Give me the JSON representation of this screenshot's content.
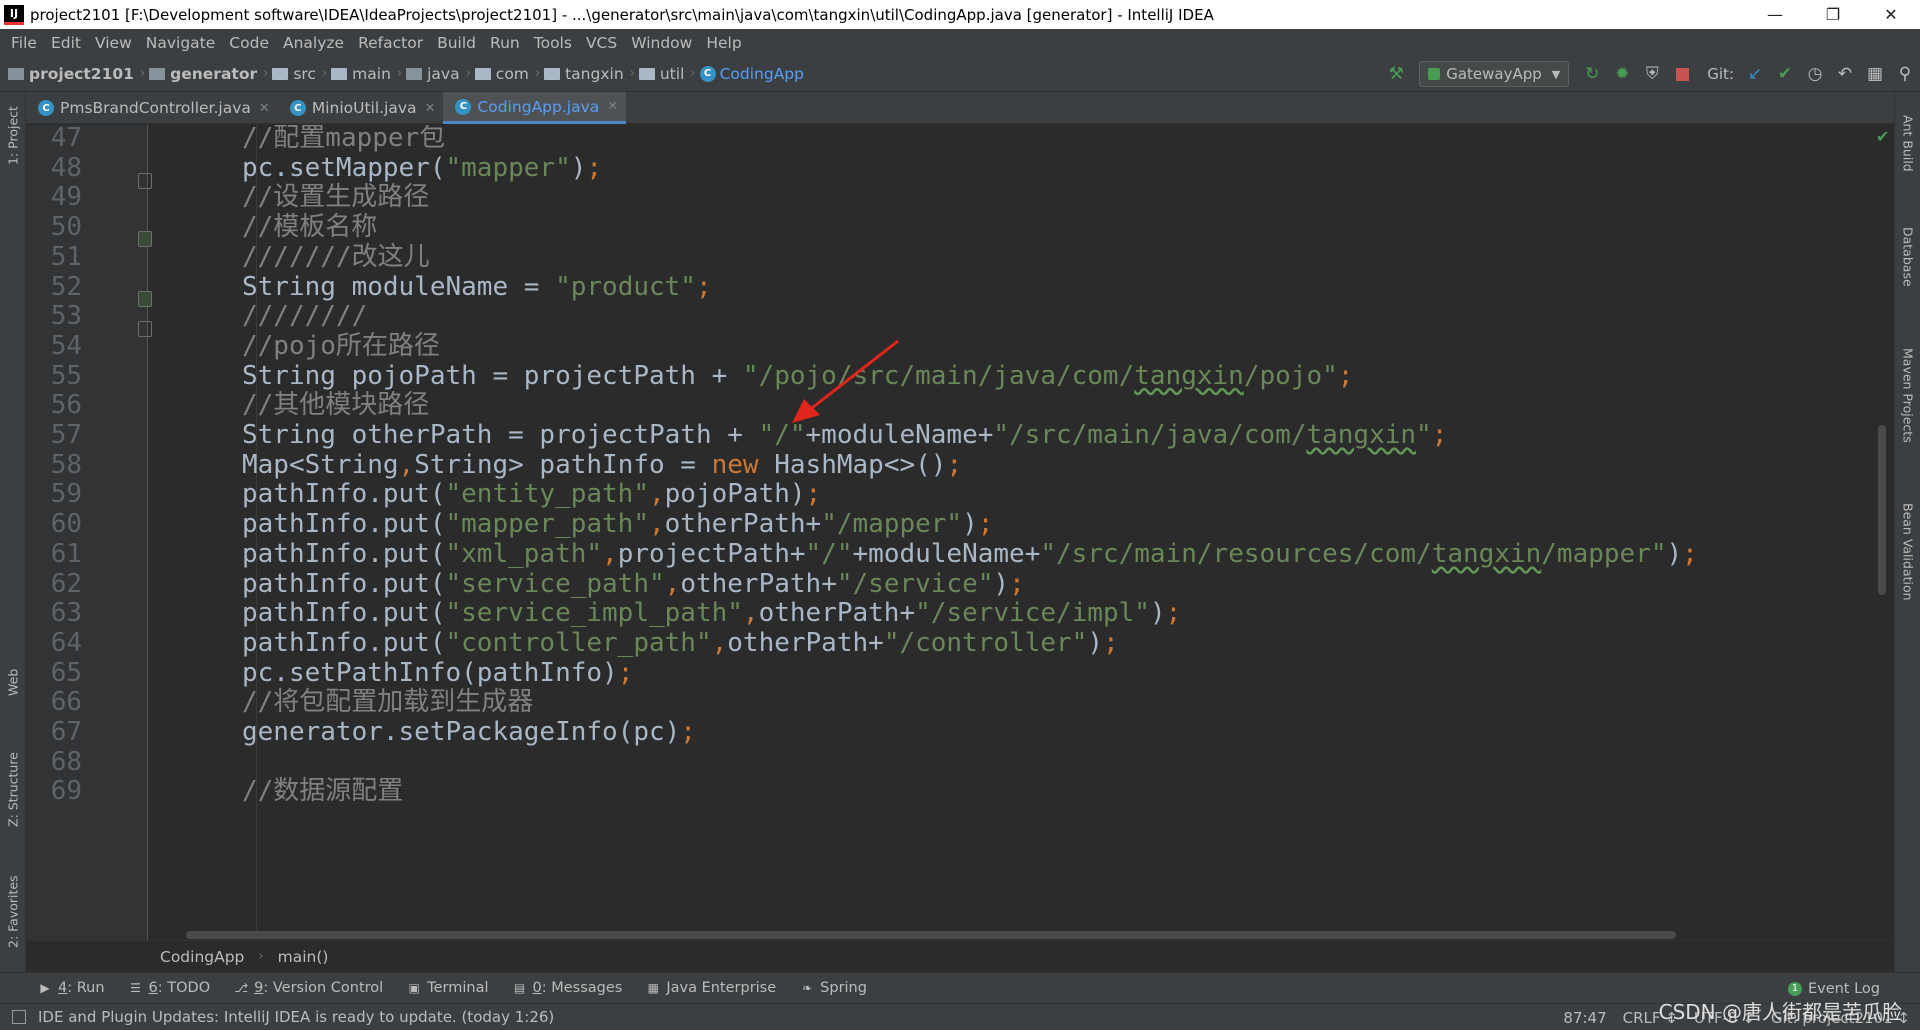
{
  "titlebar": {
    "app_icon": "IJ",
    "title": "project2101 [F:\\Development software\\IDEA\\IdeaProjects\\project2101] - ...\\generator\\src\\main\\java\\com\\tangxin\\util\\CodingApp.java [generator] - IntelliJ IDEA",
    "minimize": "—",
    "restore": "❐",
    "close": "✕"
  },
  "menu": [
    {
      "m": "F",
      "rest": "ile"
    },
    {
      "m": "E",
      "rest": "dit"
    },
    {
      "m": "V",
      "rest": "iew"
    },
    {
      "m": "N",
      "rest": "avigate"
    },
    {
      "m": "C",
      "rest": "ode"
    },
    {
      "m": "",
      "rest": "Analy",
      "tail": "z",
      "end": "e"
    },
    {
      "m": "R",
      "rest": "efactor"
    },
    {
      "m": "B",
      "rest": "uild"
    },
    {
      "m": "R",
      "rest": "u",
      "end": "n"
    },
    {
      "m": "T",
      "rest": "ools"
    },
    {
      "m": "",
      "rest": "VC",
      "tail": "S"
    },
    {
      "m": "W",
      "rest": "indow"
    },
    {
      "m": "H",
      "rest": "elp"
    }
  ],
  "menu_labels": [
    "File",
    "Edit",
    "View",
    "Navigate",
    "Code",
    "Analyze",
    "Refactor",
    "Build",
    "Run",
    "Tools",
    "VCS",
    "Window",
    "Help"
  ],
  "nav": {
    "crumbs": [
      "project2101",
      "generator",
      "src",
      "main",
      "java",
      "com",
      "tangxin",
      "util",
      "CodingApp"
    ],
    "class_icon": "C",
    "run_config": "GatewayApp",
    "git_label": "Git:"
  },
  "tabs": [
    {
      "label": "PmsBrandController.java",
      "icon": "C"
    },
    {
      "label": "MinioUtil.java",
      "icon": "C"
    },
    {
      "label": "CodingApp.java",
      "icon": "C",
      "active": true
    }
  ],
  "left_tools": [
    "1: Project",
    "Web",
    "Z: Structure",
    "2: Favorites"
  ],
  "right_tools": [
    "Ant Build",
    "Database",
    "Maven Projects",
    "Bean Validation"
  ],
  "code_lines": [
    {
      "n": "47",
      "parts": [
        [
          "c-cmt",
          "//配置mapper包"
        ]
      ]
    },
    {
      "n": "48",
      "parts": [
        [
          "c-id",
          "pc.setMapper("
        ],
        [
          "c-str",
          "\"mapper\""
        ],
        [
          "c-id",
          ")"
        ],
        [
          "c-kw",
          ";"
        ]
      ]
    },
    {
      "n": "49",
      "parts": [
        [
          "c-cmt",
          "//设置生成路径"
        ]
      ]
    },
    {
      "n": "50",
      "parts": [
        [
          "c-cmt",
          "//模板名称"
        ]
      ]
    },
    {
      "n": "51",
      "parts": [
        [
          "c-cmt",
          "///////改这儿"
        ]
      ]
    },
    {
      "n": "52",
      "parts": [
        [
          "c-id",
          "String moduleName = "
        ],
        [
          "c-str",
          "\"product\""
        ],
        [
          "c-kw",
          ";"
        ]
      ]
    },
    {
      "n": "53",
      "parts": [
        [
          "c-cmt",
          "////////"
        ]
      ]
    },
    {
      "n": "54",
      "parts": [
        [
          "c-cmt",
          "//pojo所在路径"
        ]
      ]
    },
    {
      "n": "55",
      "parts": [
        [
          "c-id",
          "String pojoPath = projectPath + "
        ],
        [
          "c-str",
          "\"/pojo/src/main/java/com/"
        ],
        [
          "c-str c-typo",
          "tangxin"
        ],
        [
          "c-str",
          "/pojo\""
        ],
        [
          "c-kw",
          ";"
        ]
      ]
    },
    {
      "n": "56",
      "parts": [
        [
          "c-cmt",
          "//其他模块路径"
        ]
      ]
    },
    {
      "n": "57",
      "parts": [
        [
          "c-id",
          "String otherPath = projectPath + "
        ],
        [
          "c-str",
          "\"/\""
        ],
        [
          "c-id",
          "+moduleName+"
        ],
        [
          "c-str",
          "\"/src/main/java/com/"
        ],
        [
          "c-str c-typo",
          "tangxin"
        ],
        [
          "c-str",
          "\""
        ],
        [
          "c-kw",
          ";"
        ]
      ]
    },
    {
      "n": "58",
      "parts": [
        [
          "c-id",
          "Map<String"
        ],
        [
          "c-kw",
          ","
        ],
        [
          "c-id",
          "String> pathInfo = "
        ],
        [
          "c-kw",
          "new "
        ],
        [
          "c-id",
          "HashMap<>()"
        ],
        [
          "c-kw",
          ";"
        ]
      ]
    },
    {
      "n": "59",
      "parts": [
        [
          "c-id",
          "pathInfo.put("
        ],
        [
          "c-str",
          "\"entity_path\""
        ],
        [
          "c-kw",
          ","
        ],
        [
          "c-id",
          "pojoPath)"
        ],
        [
          "c-kw",
          ";"
        ]
      ]
    },
    {
      "n": "60",
      "parts": [
        [
          "c-id",
          "pathInfo.put("
        ],
        [
          "c-str",
          "\"mapper_path\""
        ],
        [
          "c-kw",
          ","
        ],
        [
          "c-id",
          "otherPath+"
        ],
        [
          "c-str",
          "\"/mapper\""
        ],
        [
          "c-id",
          ")"
        ],
        [
          "c-kw",
          ";"
        ]
      ]
    },
    {
      "n": "61",
      "parts": [
        [
          "c-id",
          "pathInfo.put("
        ],
        [
          "c-str",
          "\"xml_path\""
        ],
        [
          "c-kw",
          ","
        ],
        [
          "c-id",
          "projectPath+"
        ],
        [
          "c-str",
          "\"/\""
        ],
        [
          "c-id",
          "+moduleName+"
        ],
        [
          "c-str",
          "\"/src/main/resources/com/"
        ],
        [
          "c-str c-typo",
          "tangxin"
        ],
        [
          "c-str",
          "/mapper\""
        ],
        [
          "c-id",
          ")"
        ],
        [
          "c-kw",
          ";"
        ]
      ]
    },
    {
      "n": "62",
      "parts": [
        [
          "c-id",
          "pathInfo.put("
        ],
        [
          "c-str",
          "\"service_path\""
        ],
        [
          "c-kw",
          ","
        ],
        [
          "c-id",
          "otherPath+"
        ],
        [
          "c-str",
          "\"/service\""
        ],
        [
          "c-id",
          ")"
        ],
        [
          "c-kw",
          ";"
        ]
      ]
    },
    {
      "n": "63",
      "parts": [
        [
          "c-id",
          "pathInfo.put("
        ],
        [
          "c-str",
          "\"service_impl_path\""
        ],
        [
          "c-kw",
          ","
        ],
        [
          "c-id",
          "otherPath+"
        ],
        [
          "c-str",
          "\"/service/impl\""
        ],
        [
          "c-id",
          ")"
        ],
        [
          "c-kw",
          ";"
        ]
      ]
    },
    {
      "n": "64",
      "parts": [
        [
          "c-id",
          "pathInfo.put("
        ],
        [
          "c-str",
          "\"controller_path\""
        ],
        [
          "c-kw",
          ","
        ],
        [
          "c-id",
          "otherPath+"
        ],
        [
          "c-str",
          "\"/controller\""
        ],
        [
          "c-id",
          ")"
        ],
        [
          "c-kw",
          ";"
        ]
      ]
    },
    {
      "n": "65",
      "parts": [
        [
          "c-id",
          "pc.setPathInfo(pathInfo)"
        ],
        [
          "c-kw",
          ";"
        ]
      ]
    },
    {
      "n": "66",
      "parts": [
        [
          "c-cmt",
          "//将包配置加载到生成器"
        ]
      ]
    },
    {
      "n": "67",
      "parts": [
        [
          "c-id",
          "generator.setPackageInfo(pc)"
        ],
        [
          "c-kw",
          ";"
        ]
      ]
    },
    {
      "n": "68",
      "parts": []
    },
    {
      "n": "69",
      "parts": [
        [
          "c-cmt",
          "//数据源配置"
        ]
      ]
    }
  ],
  "editor_crumbs": [
    "CodingApp",
    "main()"
  ],
  "tool_windows": [
    {
      "mn": "4",
      "rest": ": Run",
      "icon": "▶"
    },
    {
      "mn": "6",
      "rest": ": TODO",
      "icon": "☰"
    },
    {
      "mn": "9",
      "rest": ": Version Control",
      "icon": "⎇"
    },
    {
      "mn": "",
      "rest": "Terminal",
      "icon": "▣"
    },
    {
      "mn": "0",
      "rest": ": Messages",
      "icon": "▤"
    },
    {
      "mn": "",
      "rest": "Java Enterprise",
      "icon": "▦"
    },
    {
      "mn": "",
      "rest": "Spring",
      "icon": "❧"
    }
  ],
  "event_log": {
    "badge": "1",
    "label": "Event Log"
  },
  "status": {
    "message": "IDE and Plugin Updates: IntelliJ IDEA is ready to update. (today 1:26)",
    "position": "87:47",
    "line_sep": "CRLF ↕",
    "encoding": "UTF-8 ↕",
    "git": "Git: project2101 ↕"
  },
  "watermark": "CSDN @唐人街都是苦瓜脸",
  "colors": {
    "accent": "#589df6",
    "string": "#6a8759",
    "keyword": "#cc7832",
    "comment": "#808080"
  }
}
